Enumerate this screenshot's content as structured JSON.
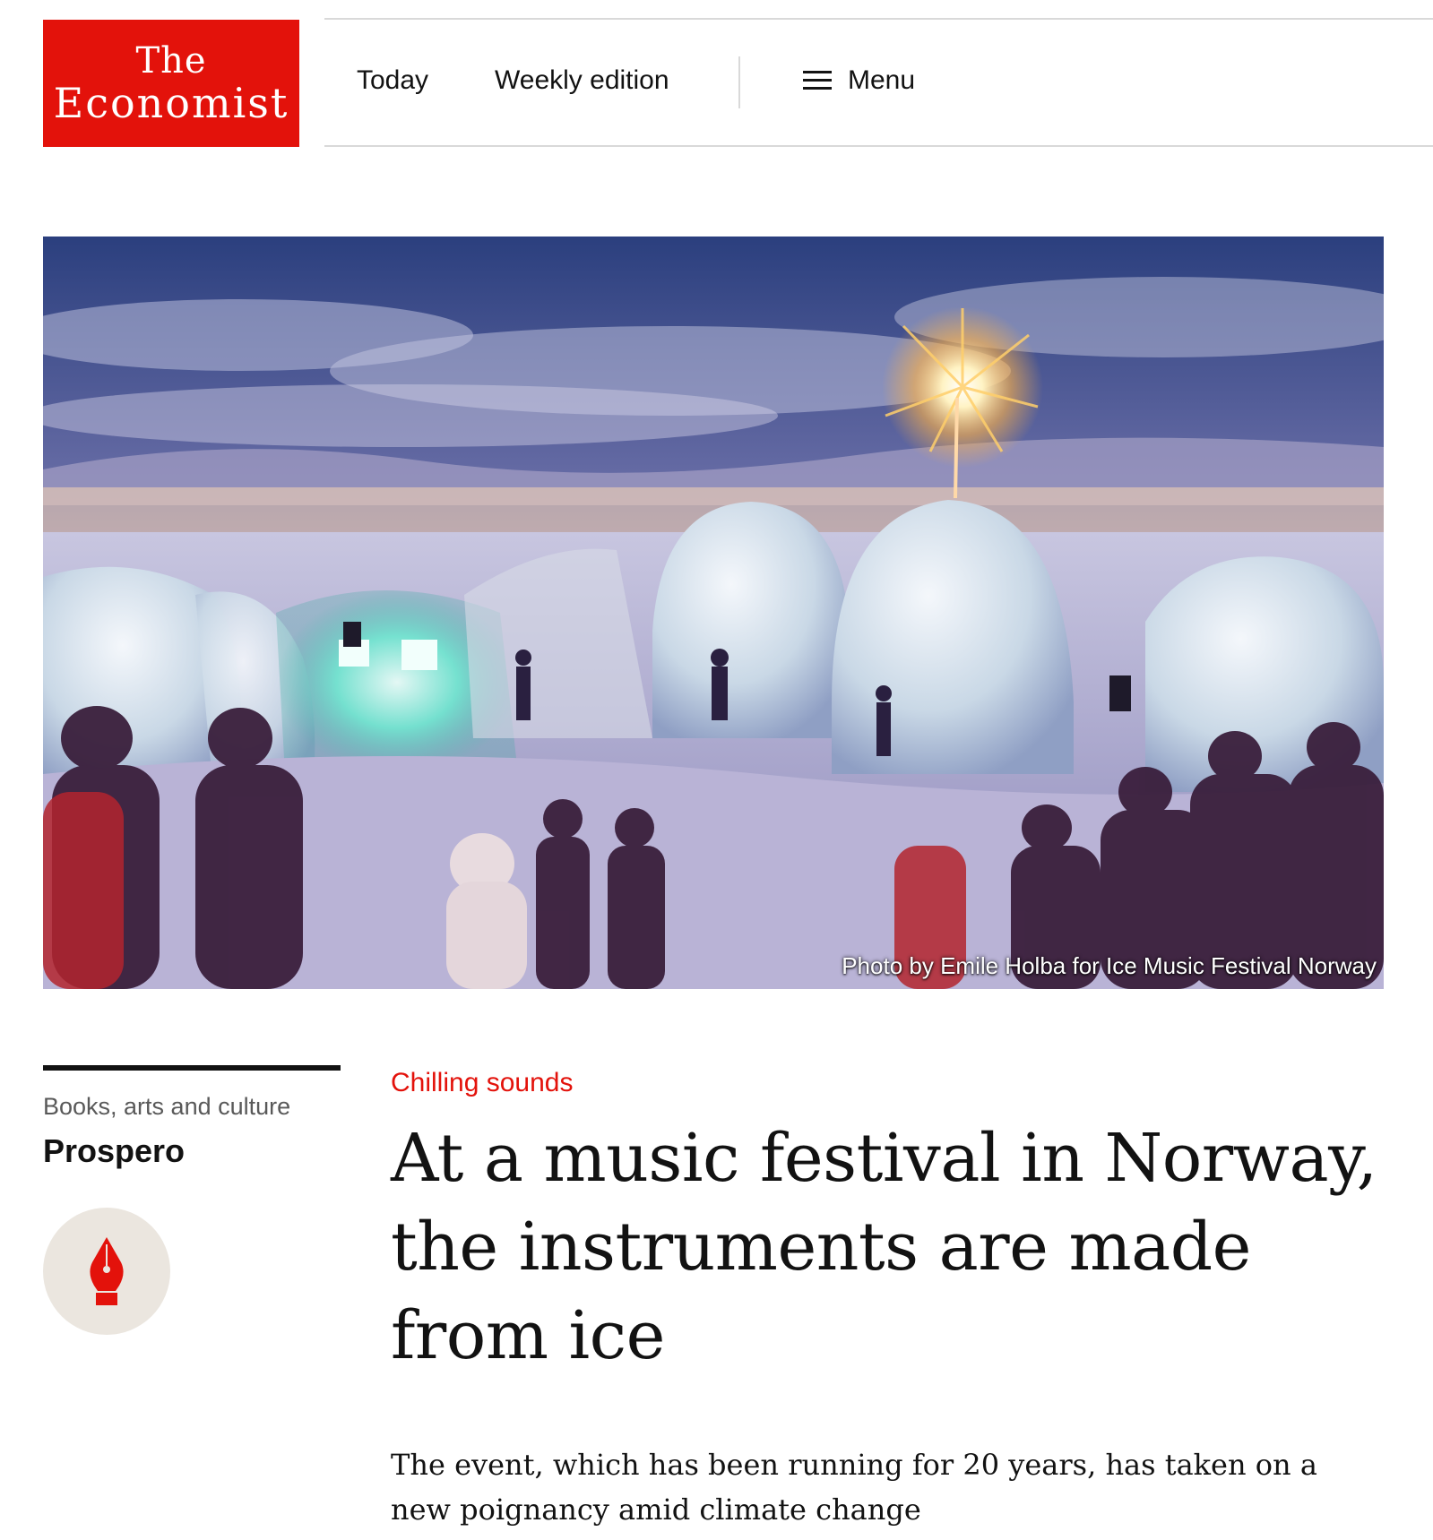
{
  "header": {
    "logo": {
      "line1": "The",
      "line2": "Economist"
    },
    "nav": {
      "today": "Today",
      "weekly": "Weekly edition",
      "menu": "Menu"
    }
  },
  "hero": {
    "caption": "Photo by Emile Holba for Ice Music Festival Norway"
  },
  "rail": {
    "section": "Books, arts and culture",
    "column": "Prospero",
    "badge_icon": "fountain-pen-nib-icon"
  },
  "article": {
    "rubric": "Chilling sounds",
    "headline": "At a music festival in Norway, the instruments are made from ice",
    "standfirst": "The event, which has been running for 20 years, has taken on a new poignancy amid climate change"
  },
  "colors": {
    "brand_red": "#e3120b",
    "text": "#121212",
    "muted": "#595959",
    "rule": "#d9d9d9",
    "badge_bg": "#ebe6df"
  }
}
